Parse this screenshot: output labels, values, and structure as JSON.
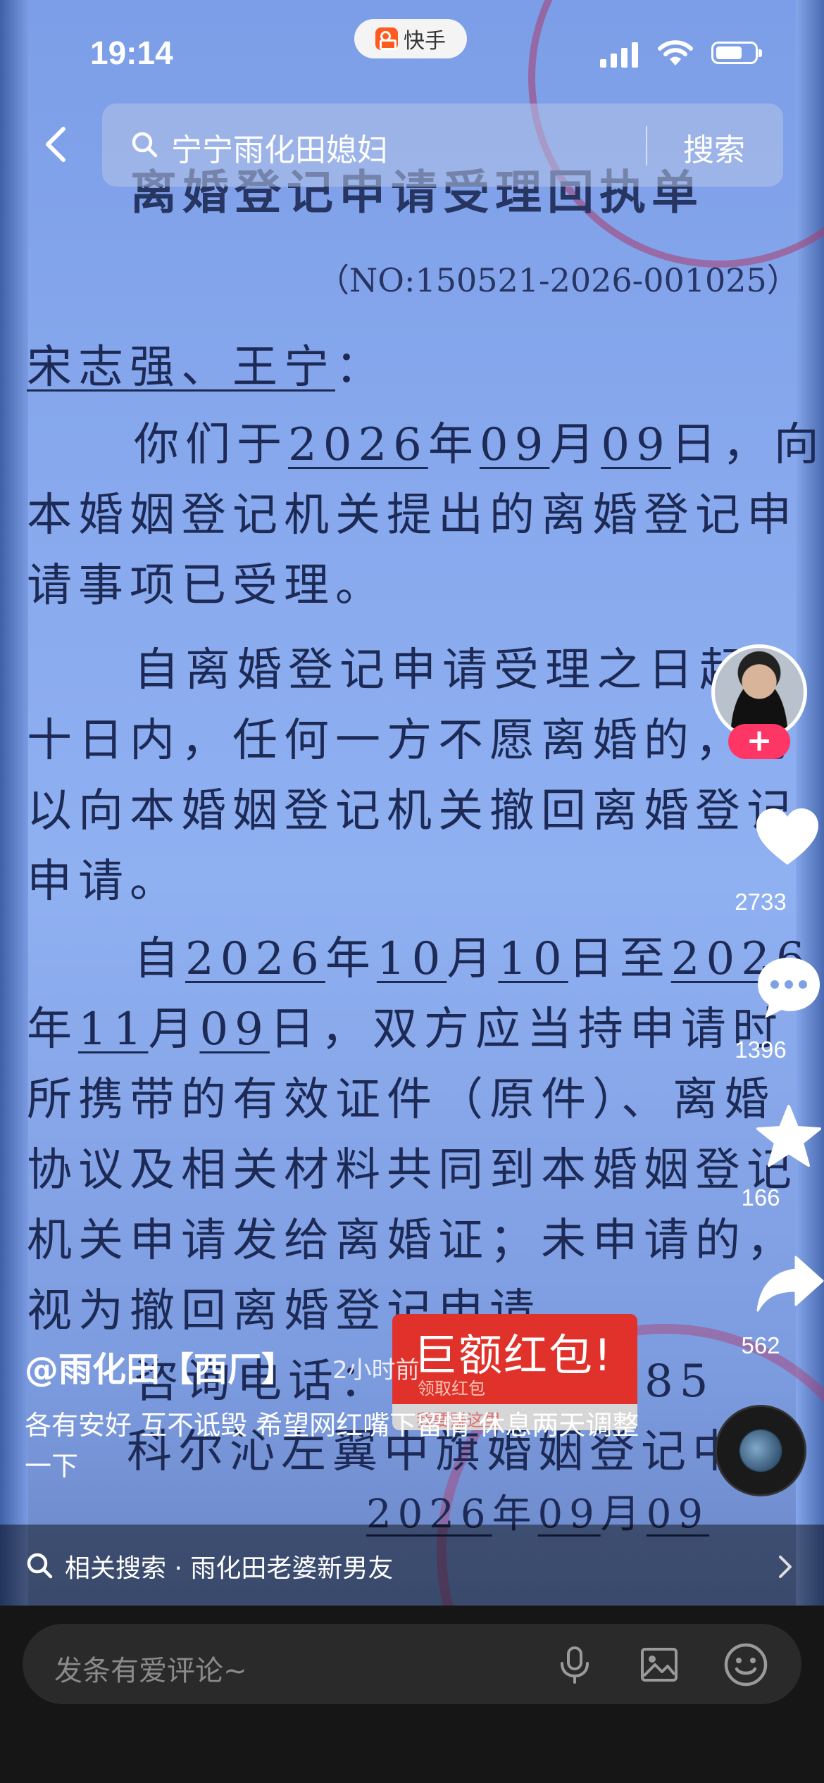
{
  "status": {
    "time": "19:14",
    "app_name": "快手"
  },
  "search": {
    "query": "宁宁雨化田媳妇",
    "button_label": "搜索"
  },
  "document": {
    "title": "离婚登记申请受理回执单",
    "number": "（NO:150521-2026-001025）",
    "addressee": "宋志强、王宁",
    "colon": "：",
    "unit_year": "年",
    "unit_month": "月",
    "p1_a": "你们于",
    "p1_year": "2026",
    "p1_month": "09",
    "p1_day": "09",
    "p1_b": "日，向",
    "p3_a": "自",
    "p3_year1": "2026",
    "p3_month1": "10",
    "p3_day1": "10",
    "p3_b": "日至",
    "p3_year2": "2026",
    "p3_month2": "11",
    "p3_day2": "09",
    "p3_c": "日，双方应当持申请时",
    "lines": [
      "本婚姻登记机关提出的离婚登记申",
      "请事项已受理。",
      "自离婚登记申请受理之日起",
      "十日内，任何一方不愿离婚的，可",
      "以向本婚姻登记机关撤回离婚登记",
      "申请。",
      "所携带的有效证件（原件）、离婚",
      "协议及相关材料共同到本婚姻登记",
      "机关申请发给离婚证；未申请的，",
      "视为撤回离婚登记申请。"
    ],
    "phone_label": "咨询电话：",
    "phone_tail": "85",
    "issuer": "科尔沁左翼中旗婚姻登记中"
  },
  "rail": {
    "follow_label": "+",
    "likes": "2733",
    "comments": "1396",
    "favorites": "166",
    "shares": "562"
  },
  "red_packet": {
    "title": "巨额红包!",
    "subtitle": "领取红包",
    "strip_text": "我要赚这里"
  },
  "post": {
    "author": "@雨化田【西厂】",
    "time_ago": "2小时前",
    "caption": "各有安好 互不诋毁 希望网红嘴下留情 休息两天调整一下"
  },
  "related": {
    "text": "相关搜索 · 雨化田老婆新男友"
  },
  "comment": {
    "placeholder": "发条有爱评论~"
  }
}
